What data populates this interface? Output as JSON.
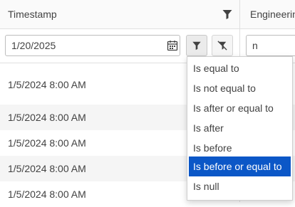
{
  "header": {
    "timestamp_label": "Timestamp",
    "engineering_label": "Engineerin"
  },
  "filter": {
    "date_value": "1/20/2025",
    "engineering_value": "n"
  },
  "rows": [
    {
      "timestamp": "1/5/2024 8:00 AM"
    },
    {
      "timestamp": "1/5/2024 8:00 AM"
    },
    {
      "timestamp": "1/5/2024 8:00 AM"
    },
    {
      "timestamp": "1/5/2024 8:00 AM"
    },
    {
      "timestamp": "1/5/2024 8:00 AM"
    }
  ],
  "menu": {
    "items": [
      "Is equal to",
      "Is not equal to",
      "Is after or equal to",
      "Is after",
      "Is before",
      "Is before or equal to",
      "Is null"
    ],
    "selected": "Is before or equal to"
  },
  "colors": {
    "selected_bg": "#0b57c7",
    "header_bg": "#fafafa",
    "alt_row_bg": "#f5f5f5"
  },
  "icons": [
    "funnel-icon",
    "calendar-icon",
    "filter-clear-icon"
  ]
}
